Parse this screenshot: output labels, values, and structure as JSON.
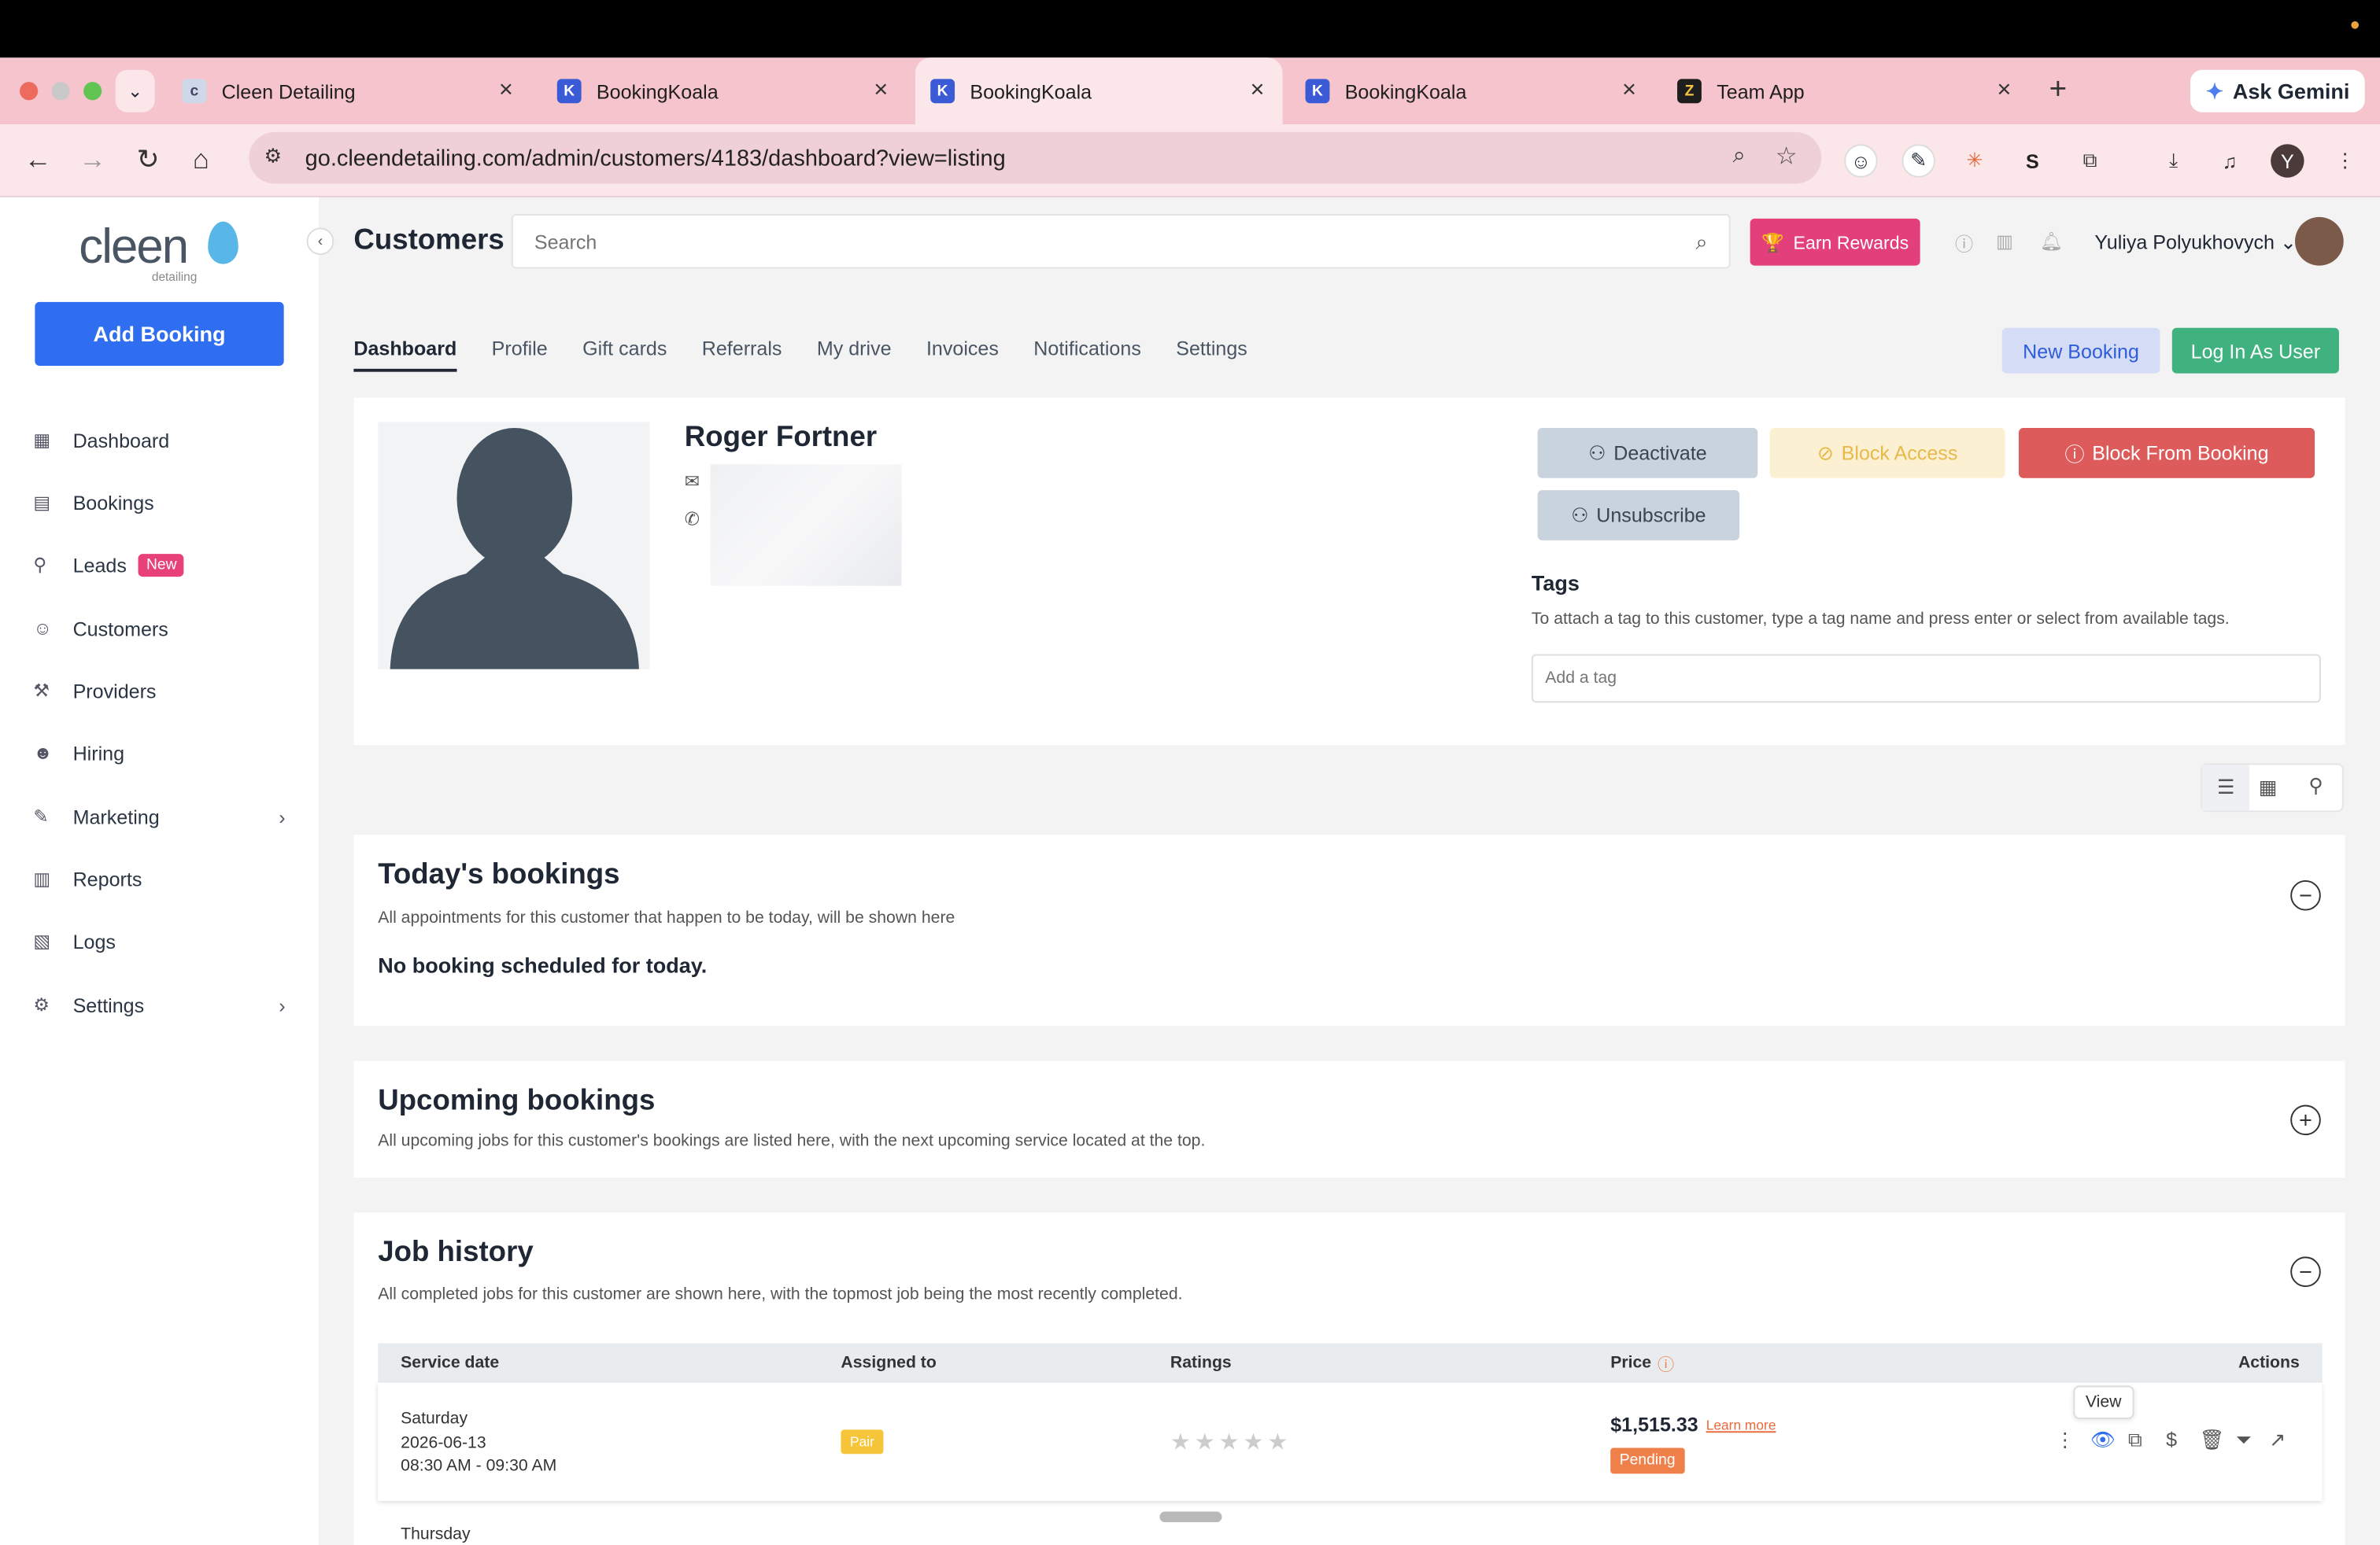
{
  "browser": {
    "tabs": [
      {
        "title": "Cleen Detailing",
        "icon": "cleen-favicon"
      },
      {
        "title": "BookingKoala",
        "icon": "bookingkoala-favicon"
      },
      {
        "title": "BookingKoala",
        "icon": "bookingkoala-favicon"
      },
      {
        "title": "BookingKoala",
        "icon": "bookingkoala-favicon"
      },
      {
        "title": "Team App",
        "icon": "zapier-favicon"
      }
    ],
    "active_tab": 2,
    "new_tab": "+",
    "ask_gemini": "Ask Gemini",
    "url": "go.cleendetailing.com/admin/customers/4183/dashboard?view=listing",
    "profile_initial": "Y"
  },
  "sidebar": {
    "logo": "cleen",
    "logo_sub": "detailing",
    "add_booking": "Add Booking",
    "items": [
      {
        "label": "Dashboard",
        "icon": "dashboard-icon"
      },
      {
        "label": "Bookings",
        "icon": "calendar-icon"
      },
      {
        "label": "Leads",
        "icon": "leads-icon",
        "badge": "New"
      },
      {
        "label": "Customers",
        "icon": "customers-icon"
      },
      {
        "label": "Providers",
        "icon": "providers-icon"
      },
      {
        "label": "Hiring",
        "icon": "hiring-icon"
      },
      {
        "label": "Marketing",
        "icon": "marketing-icon"
      },
      {
        "label": "Reports",
        "icon": "reports-icon"
      },
      {
        "label": "Logs",
        "icon": "logs-icon"
      },
      {
        "label": "Settings",
        "icon": "gear-icon"
      }
    ]
  },
  "header": {
    "title": "Customers",
    "search_placeholder": "Search",
    "earn_rewards": "Earn Rewards",
    "user_name": "Yuliya Polyukhovych"
  },
  "customer_tabs": [
    "Dashboard",
    "Profile",
    "Gift cards",
    "Referrals",
    "My drive",
    "Invoices",
    "Notifications",
    "Settings"
  ],
  "actions": {
    "new_booking": "New Booking",
    "log_in_as_user": "Log In As User"
  },
  "customer": {
    "name": "Roger Fortner",
    "deactivate": "Deactivate",
    "block_access": "Block Access",
    "block_from_booking": "Block From Booking",
    "unsubscribe": "Unsubscribe",
    "tags_title": "Tags",
    "tags_help": "To attach a tag to this customer, type a tag name and press enter or select from available tags.",
    "tag_placeholder": "Add a tag"
  },
  "todays_bookings": {
    "title": "Today's bookings",
    "subtitle": "All appointments for this customer that happen to be today, will be shown here",
    "empty": "No booking scheduled for today."
  },
  "upcoming_bookings": {
    "title": "Upcoming bookings",
    "subtitle": "All upcoming jobs for this customer's bookings are listed here, with the next upcoming service located at the top."
  },
  "job_history": {
    "title": "Job history",
    "subtitle": "All completed jobs for this customer are shown here, with the topmost job being the most recently completed.",
    "columns": [
      "Service date",
      "Assigned to",
      "Ratings",
      "Price",
      "Actions"
    ],
    "rows": [
      {
        "day": "Saturday",
        "date": "2026-06-13",
        "time": "08:30 AM - 09:30 AM",
        "assigned": "Pair",
        "rating": 0,
        "price": "$1,515.33",
        "learn_more": "Learn more",
        "status": "Pending"
      }
    ],
    "next_row_day": "Thursday",
    "tooltip": "View"
  },
  "colors": {
    "accent_blue": "#2f6ef0",
    "earn_pink": "#e23f7b",
    "log_in_green": "#3fb27f",
    "block_red": "#de5b5b",
    "pending_orange": "#f0804a"
  }
}
